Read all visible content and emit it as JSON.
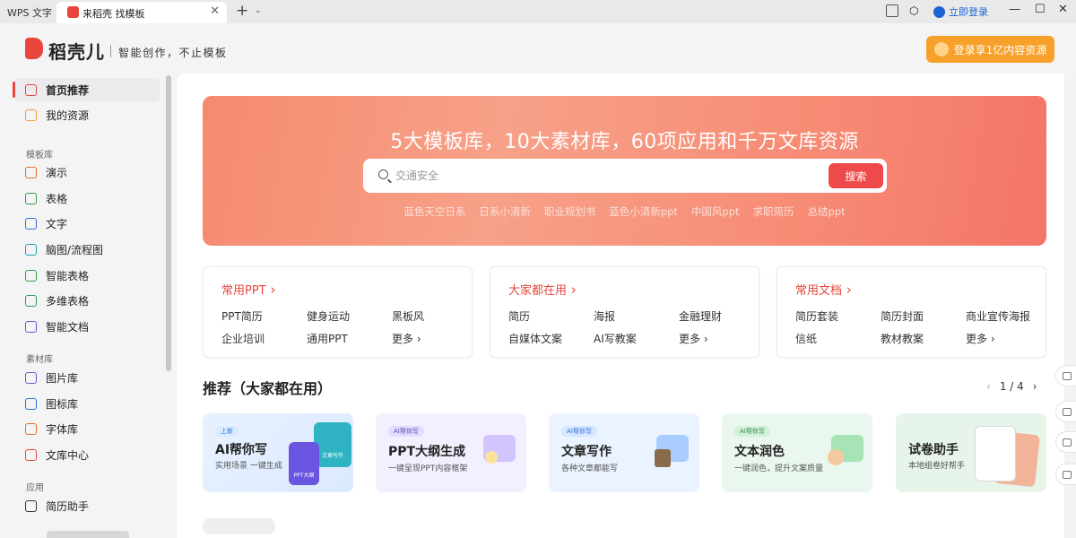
{
  "titlebar": {
    "app_name": "WPS 文字",
    "tab_title": "来稻壳 找模板",
    "login": "立即登录"
  },
  "header": {
    "logo": "稻壳儿",
    "slogan": "智能创作，不止模板",
    "vip_button": "登录享1亿内容资源"
  },
  "sidebar": {
    "top_items": [
      {
        "label": "首页推荐",
        "icon": "home-icon"
      },
      {
        "label": "我的资源",
        "icon": "folder-icon"
      }
    ],
    "template_section": "模板库",
    "template_items": [
      {
        "label": "演示",
        "icon": "presentation-icon",
        "color": "#e86a2f"
      },
      {
        "label": "表格",
        "icon": "spreadsheet-icon",
        "color": "#3e9a49"
      },
      {
        "label": "文字",
        "icon": "document-icon",
        "color": "#2f6fdc"
      },
      {
        "label": "脑图/流程图",
        "icon": "mindmap-icon",
        "color": "#1aa6b2"
      },
      {
        "label": "智能表格",
        "icon": "smart-table-icon",
        "color": "#3e9a49"
      },
      {
        "label": "多维表格",
        "icon": "multi-table-icon",
        "color": "#2f9a55"
      },
      {
        "label": "智能文档",
        "icon": "smart-doc-icon",
        "color": "#7a4fd8"
      }
    ],
    "material_section": "素材库",
    "material_items": [
      {
        "label": "图片库",
        "icon": "image-icon",
        "color": "#6b5ad8"
      },
      {
        "label": "图标库",
        "icon": "icons-grid-icon",
        "color": "#2f6fdc"
      },
      {
        "label": "字体库",
        "icon": "font-icon",
        "color": "#e86a2f"
      },
      {
        "label": "文库中心",
        "icon": "library-icon",
        "color": "#e8453c"
      }
    ],
    "app_section": "应用",
    "app_items": [
      {
        "label": "简历助手",
        "icon": "resume-icon",
        "color": "#333333"
      }
    ]
  },
  "banner": {
    "title": "5大模板库，10大素材库，60项应用和千万文库资源",
    "search_placeholder": "交通安全",
    "search_button": "搜索",
    "tags": [
      "蓝色天空日系",
      "日系小清新",
      "职业规划书",
      "蓝色小清新ppt",
      "中国风ppt",
      "求职简历",
      "总结ppt"
    ]
  },
  "cards": [
    {
      "title": "常用PPT",
      "links": [
        "PPT简历",
        "健身运动",
        "黑板风",
        "企业培训",
        "通用PPT",
        "更多 ›"
      ]
    },
    {
      "title": "大家都在用",
      "links": [
        "简历",
        "海报",
        "金融理财",
        "自媒体文案",
        "AI写教案",
        "更多 ›"
      ]
    },
    {
      "title": "常用文档",
      "links": [
        "简历套装",
        "简历封面",
        "商业宣传海报",
        "信纸",
        "教材教案",
        "更多 ›"
      ]
    }
  ],
  "recommend": {
    "title": "推荐（大家都在用）",
    "page": "1 / 4",
    "items": [
      {
        "badge": "上新",
        "title": "AI帮你写",
        "sub": "实用场景 一键生成",
        "art1": "文章写作",
        "art2": "PPT大纲",
        "bg": "#e3efff"
      },
      {
        "badge": "AI帮你写",
        "title": "PPT大纲生成",
        "sub": "一键呈现PPT内容框架",
        "bg": "#f3efff"
      },
      {
        "badge": "AI帮你写",
        "title": "文章写作",
        "sub": "各种文章都能写",
        "bg": "#eaf3ff"
      },
      {
        "badge": "AI帮你写",
        "title": "文本润色",
        "sub": "一键润色，提升文案质量",
        "bg": "#eaf7ee"
      },
      {
        "badge": "",
        "title": "试卷助手",
        "sub": "本地组卷好帮手",
        "bg": "#e6f4ea"
      }
    ]
  }
}
